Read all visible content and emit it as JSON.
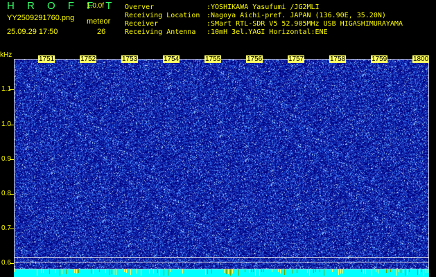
{
  "header": {
    "title": "H R O F F T",
    "version": "1.0.0f",
    "filename": "YY2509291760.png",
    "meteor_label": "meteor",
    "datetime": "25.09.29 17:50",
    "meteor_count": "26"
  },
  "info": [
    {
      "key": "Overver",
      "value": ":YOSHIKAWA Yasufumi /JG2MLI"
    },
    {
      "key": "Receiving Location",
      "value": ":Nagoya Aichi-pref. JAPAN (136.90E, 35.20N)"
    },
    {
      "key": "Receiver",
      "value": ":SMart RTL-SDR V5 52.905MHz USB HIGASHIMURAYAMA"
    },
    {
      "key": "Receiving Antenna",
      "value": ":10mH 3el.YAGI Horizontal:ENE"
    }
  ],
  "spectrogram": {
    "y_unit": "kHz",
    "y_labels": [
      "1.1",
      "1.0",
      "0.9",
      "0.8",
      "0.7",
      "0.6"
    ],
    "x_labels": [
      "1751",
      "1752",
      "1753",
      "1754",
      "1755",
      "1756",
      "1757",
      "1758",
      "1759",
      "1800"
    ],
    "colors": {
      "background": "#000080",
      "noise_bright": "#4a8cff",
      "noise_dim": "#1f3fd0",
      "bottom_bar": "#00ffff",
      "labels": "#ffff00"
    }
  }
}
